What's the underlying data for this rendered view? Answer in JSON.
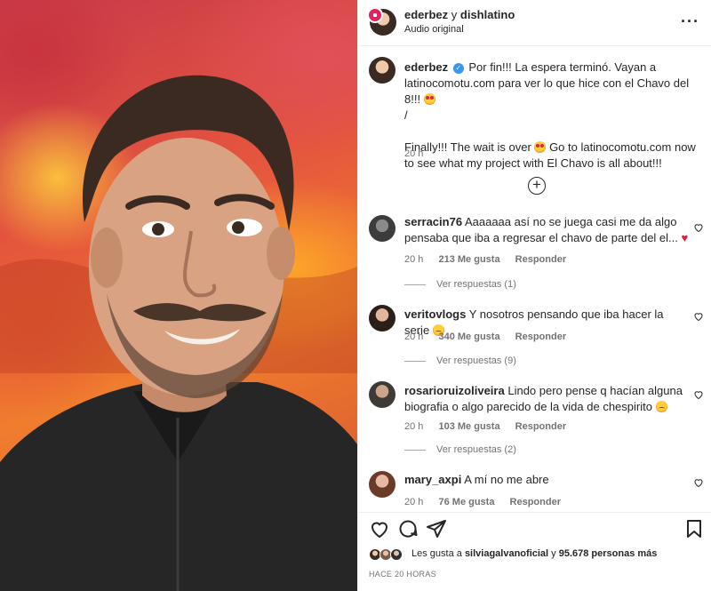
{
  "post": {
    "header": {
      "username": "ederbez",
      "collab_joiner": "y",
      "collab_username": "dishlatino",
      "audio": "Audio original"
    },
    "caption": {
      "username": "ederbez",
      "text_es": "Por fin!!! La espera terminó. Vayan a latinocomotu.com para ver lo que hice con el Chavo del 8!!!",
      "separator": "/",
      "text_en_1": "Finally!!! The wait is over",
      "text_en_2": "Go to latinocomotu.com now to see what my project with El Chavo is all about!!!",
      "time": "20 h"
    },
    "comments": [
      {
        "username": "serracin76",
        "text": "Aaaaaaa así no se juega casi me da algo pensaba que iba a regresar el chavo de parte del el...",
        "time": "20 h",
        "likes": "213 Me gusta",
        "reply": "Responder",
        "replies": "Ver respuestas (1)"
      },
      {
        "username": "veritovlogs",
        "text": "Y nosotros pensando que iba hacer la serie",
        "time": "20 h",
        "likes": "340 Me gusta",
        "reply": "Responder",
        "replies": "Ver respuestas (9)"
      },
      {
        "username": "rosarioruizoliveira",
        "text": "Lindo pero pense q hacían alguna biografia o algo parecido de la vida de chespirito",
        "time": "20 h",
        "likes": "103 Me gusta",
        "reply": "Responder",
        "replies": "Ver respuestas (2)"
      },
      {
        "username": "mary_axpi",
        "text": "A mí no me abre",
        "time": "20 h",
        "likes": "76 Me gusta",
        "reply": "Responder"
      }
    ],
    "likes_prefix": "Les gusta a",
    "likes_user": "silviagalvanoficial",
    "likes_suffix": "y",
    "likes_count": "95.678 personas más",
    "date": "HACE 20 HORAS"
  },
  "icons": [
    "more-icon",
    "verified-icon",
    "add-comment-icon",
    "heart-icon",
    "comment-icon",
    "share-icon",
    "save-icon"
  ],
  "colors": {
    "link_blue": "#3897f0",
    "heart_red": "#e0203a",
    "muted": "#737373",
    "text": "#262626"
  }
}
